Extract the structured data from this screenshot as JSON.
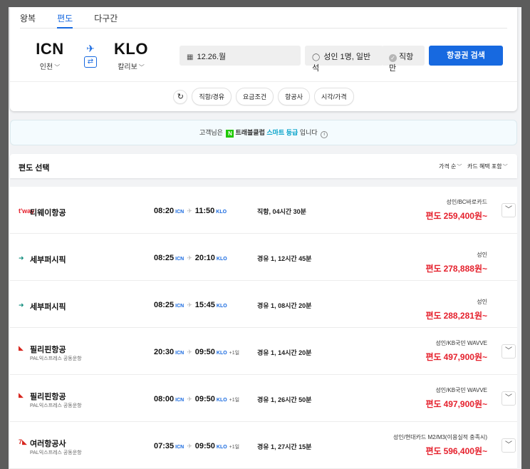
{
  "tabs": [
    {
      "label": "왕복",
      "active": false
    },
    {
      "label": "편도",
      "active": true
    },
    {
      "label": "다구간",
      "active": false
    }
  ],
  "route": {
    "departure": {
      "code": "ICN",
      "city": "인천"
    },
    "arrival": {
      "code": "KLO",
      "city": "칼리보"
    }
  },
  "search": {
    "date": "12.26.월",
    "passengers": "성인 1명, 일반석",
    "direct_only": "직항만",
    "button": "항공권 검색"
  },
  "filters": [
    "직항/경유",
    "요금조건",
    "항공사",
    "시각/가격"
  ],
  "notice": {
    "prefix": "고객님은",
    "logo": "N",
    "brand": "트래블클럽",
    "grade": "스마트 등급",
    "suffix": "입니다"
  },
  "results": {
    "title": "편도 선택",
    "sort_price": "가격 순",
    "sort_card": "카드 혜택 포함",
    "price_prefix": "편도",
    "flights": [
      {
        "logo": "t'way",
        "logo_color": "#e5202c",
        "airline": "티웨이항공",
        "codeshare": "",
        "dep_time": "08:20",
        "dep_ap": "ICN",
        "arr_time": "11:50",
        "arr_ap": "KLO",
        "day_plus": "",
        "duration": "직항, 04시간 30분",
        "price_info": "성인/BC바로카드",
        "price": "259,400원~",
        "expandable": true
      },
      {
        "logo": "➜",
        "logo_color": "#0a8a7a",
        "airline": "세부퍼시픽",
        "codeshare": "",
        "dep_time": "08:25",
        "dep_ap": "ICN",
        "arr_time": "20:10",
        "arr_ap": "KLO",
        "day_plus": "",
        "duration": "경유 1, 12시간 45분",
        "price_info": "성인",
        "price": "278,888원~",
        "expandable": false
      },
      {
        "logo": "➜",
        "logo_color": "#0a8a7a",
        "airline": "세부퍼시픽",
        "codeshare": "",
        "dep_time": "08:25",
        "dep_ap": "ICN",
        "arr_time": "15:45",
        "arr_ap": "KLO",
        "day_plus": "",
        "duration": "경유 1, 08시간 20분",
        "price_info": "성인",
        "price": "288,281원~",
        "expandable": false
      },
      {
        "logo": "◣",
        "logo_color": "#d7261e",
        "airline": "필리핀항공",
        "codeshare": "PAL익스프레스 공동운항",
        "dep_time": "20:30",
        "dep_ap": "ICN",
        "arr_time": "09:50",
        "arr_ap": "KLO",
        "day_plus": "+1일",
        "duration": "경유 1, 14시간 20분",
        "price_info": "성인/KB국민 WAVVE",
        "price": "497,900원~",
        "expandable": true
      },
      {
        "logo": "◣",
        "logo_color": "#d7261e",
        "airline": "필리핀항공",
        "codeshare": "PAL익스프레스 공동운항",
        "dep_time": "08:00",
        "dep_ap": "ICN",
        "arr_time": "09:50",
        "arr_ap": "KLO",
        "day_plus": "+1일",
        "duration": "경유 1, 26시간 50분",
        "price_info": "성인/KB국민 WAVVE",
        "price": "497,900원~",
        "expandable": true
      },
      {
        "logo": "7◣",
        "logo_color": "#d7261e",
        "airline": "여러항공사",
        "codeshare": "PAL익스프레스 공동운항",
        "dep_time": "07:35",
        "dep_ap": "ICN",
        "arr_time": "09:50",
        "arr_ap": "KLO",
        "day_plus": "+1일",
        "duration": "경유 1, 27시간 15분",
        "price_info": "성인/현대카드 M2/M3(이용실적 충족시)",
        "price": "596,400원~",
        "expandable": true
      }
    ]
  },
  "colors": {
    "accent": "#1769e0",
    "price": "#e5202c"
  }
}
